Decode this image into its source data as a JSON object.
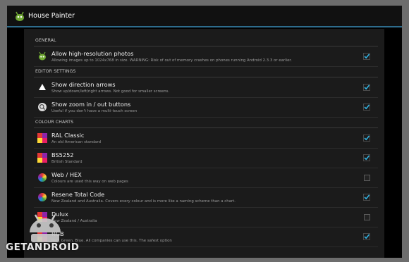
{
  "app": {
    "title": "House Painter"
  },
  "sections": {
    "general": "GENERAL",
    "editor": "EDITOR SETTINGS",
    "colour": "COLOUR CHARTS"
  },
  "settings": [
    {
      "title": "Allow high-resolution photos",
      "subtitle": "Allowing images up to 1024x768 in size. WARNING: Risk of out of memory crashes on phones running Android 2.3.3 or earlier.",
      "checked": true,
      "icon": "android-bug-icon"
    },
    {
      "title": "Show direction arrows",
      "subtitle": "Show up/down/left/right arrows. Not good for smaller screens.",
      "checked": true,
      "icon": "arrow-up-icon"
    },
    {
      "title": "Show zoom in / out buttons",
      "subtitle": "Useful if you don't have a multi-touch screen",
      "checked": true,
      "icon": "zoom-icon"
    },
    {
      "title": "RAL Classic",
      "subtitle": "An old American standard",
      "checked": true,
      "icon": "colour-swatch-icon"
    },
    {
      "title": "BS5252",
      "subtitle": "British Standard",
      "checked": true,
      "icon": "colour-swatch-icon"
    },
    {
      "title": "Web / HEX",
      "subtitle": "Colours are used this way on web pages",
      "checked": false,
      "icon": "colour-wheel-icon"
    },
    {
      "title": "Resene Total Code",
      "subtitle": "New Zealand and Australia.  Covers every colour and is more like a naming scheme than a chart.",
      "checked": true,
      "icon": "colour-wheel-icon"
    },
    {
      "title": "Dulux",
      "subtitle": "New Zealand / Australia",
      "checked": false,
      "icon": "colour-swatch-icon"
    },
    {
      "title": "RGB",
      "subtitle": "Red, Green, Blue. All companies can use this. The safest option",
      "checked": true,
      "icon": "colour-swatch-icon"
    }
  ],
  "watermark": {
    "text": "GETANDROID"
  },
  "colors": {
    "accent": "#33b5e5",
    "actionbar_line": "#2e6c8c"
  }
}
